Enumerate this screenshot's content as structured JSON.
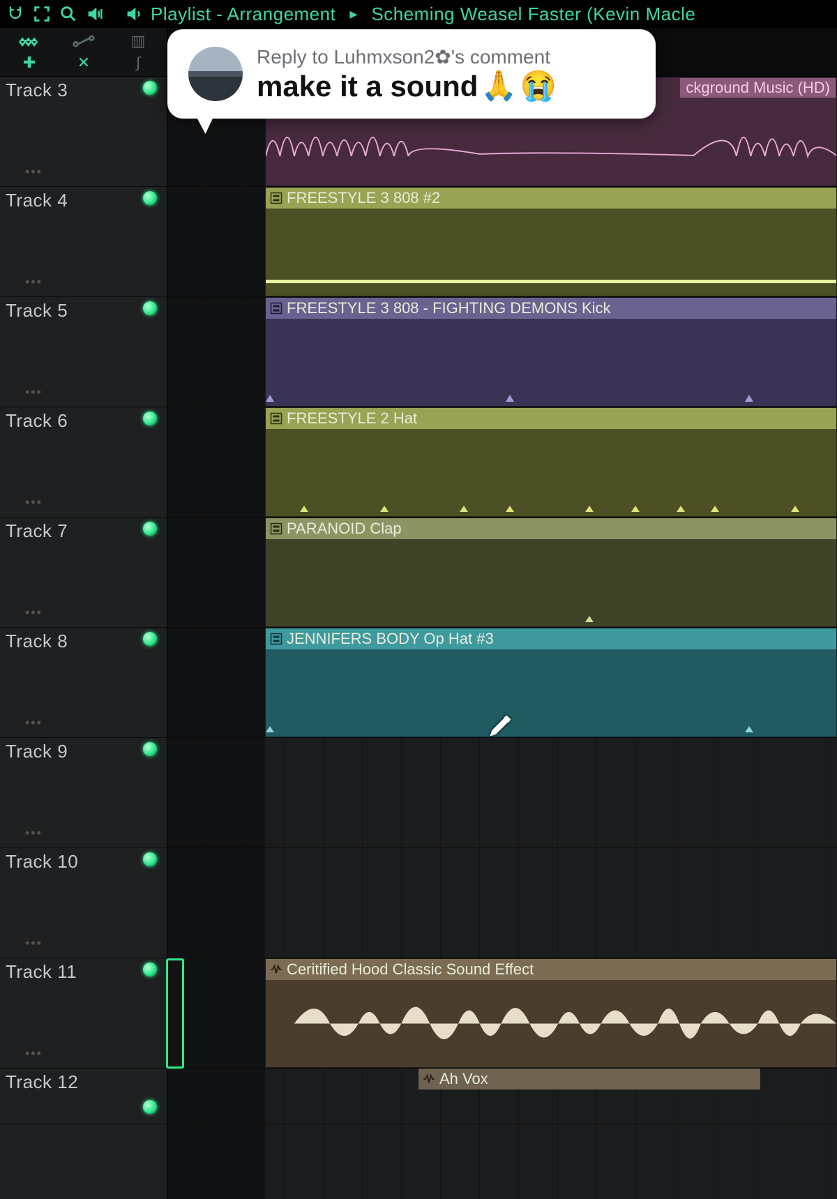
{
  "toolbar": {
    "playlist_label": "Playlist - Arrangement",
    "song_title": "Scheming Weasel Faster (Kevin Macle"
  },
  "comment_bubble": {
    "reply_line": "Reply to Luhmxson2✿'s comment",
    "main_text": "make it a sound",
    "emoji1": "🙏",
    "emoji2": "😭"
  },
  "tracks": [
    {
      "name": "Track 3",
      "led": true
    },
    {
      "name": "Track 4",
      "led": true
    },
    {
      "name": "Track 5",
      "led": true
    },
    {
      "name": "Track 6",
      "led": true
    },
    {
      "name": "Track 7",
      "led": true
    },
    {
      "name": "Track 8",
      "led": true
    },
    {
      "name": "Track 9",
      "led": true
    },
    {
      "name": "Track 10",
      "led": true
    },
    {
      "name": "Track 11",
      "led": true
    },
    {
      "name": "Track 12",
      "led": true
    }
  ],
  "clips": {
    "track3_frag": "ckground Music (HD)",
    "track4": "FREESTYLE 3 808 #2",
    "track5": "FREESTYLE 3 808 - FIGHTING DEMONS Kick",
    "track6": "FREESTYLE 2 Hat",
    "track7": "PARANOID Clap",
    "track8": "JENNIFERS BODY Op Hat #3",
    "track11": "Ceritified Hood Classic Sound Effect",
    "track12": "Ah Vox"
  },
  "colors": {
    "track3_bg": "#472a3d",
    "track3_hdr": "#8b5a7a",
    "track3_wave": "#e6a9d4",
    "track4_bg": "#4c5024",
    "track4_hdr": "#9aa253",
    "track5_bg": "#3a3353",
    "track5_hdr": "#6a6390",
    "track6_bg": "#4c5024",
    "track6_hdr": "#9aa253",
    "track7_bg": "#3f4328",
    "track7_hdr": "#8d9464",
    "track8_bg": "#1f5b60",
    "track8_hdr": "#3f9aa0",
    "track11_bg": "#4a3d2e",
    "track11_hdr": "#7d6c54",
    "track11_wave": "#e7ddc9",
    "track12_hdr": "#6f6250"
  }
}
